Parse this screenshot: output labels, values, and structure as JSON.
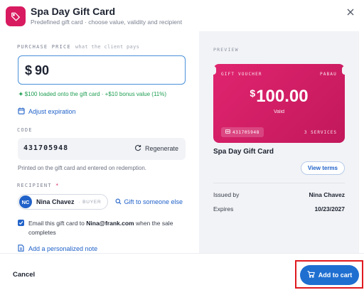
{
  "header": {
    "title": "Spa Day Gift Card",
    "subtitle": "Predefined gift card · choose value, validity and recipient",
    "icon": "tag-icon"
  },
  "form": {
    "purchase_price_label": "PURCHASE PRICE",
    "purchase_price_hint": "what the client pays",
    "currency": "$",
    "price_value": "90",
    "bonus_text": "$100 loaded onto the gift card · +$10 bonus value (11%)",
    "adjust_expiration": "Adjust expiration",
    "code_label": "CODE",
    "code_value": "431705948",
    "regenerate": "Regenerate",
    "code_note": "Printed on the gift card and entered on redemption.",
    "recipient_label": "RECIPIENT",
    "required_mark": "*",
    "recipient_initials": "NC",
    "recipient_name": "Nina Chavez",
    "recipient_role": "· BUYER",
    "gift_link": "Gift to someone else",
    "email_checked": true,
    "email_prefix": "Email this gift card to ",
    "email_address": "Nina@frank.com",
    "email_suffix": " when the sale completes",
    "add_note": "Add a personalized note"
  },
  "preview": {
    "label": "PREVIEW",
    "card_top_left": "GIFT VOUCHER",
    "card_top_right": "PABAU",
    "card_currency": "$",
    "card_value": "100.00",
    "card_valid": "Valid",
    "card_code": "431705948",
    "card_services": "3 SERVICES",
    "card_name": "Spa Day Gift Card",
    "view_terms": "View terms",
    "issued_by_label": "Issued by",
    "issued_by_value": "Nina Chavez",
    "expires_label": "Expires",
    "expires_value": "10/23/2027",
    "card_color": "#d81b60"
  },
  "footer": {
    "cancel": "Cancel",
    "add_to_cart": "Add to cart"
  },
  "colors": {
    "accent": "#2162c9",
    "brand": "#d81b60",
    "success": "#1e9e52",
    "highlight": "#e0191f"
  }
}
